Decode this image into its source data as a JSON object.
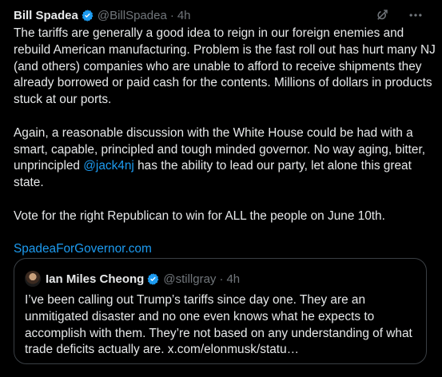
{
  "tweet": {
    "author_name": "Bill Spadea",
    "handle": "@BillSpadea",
    "separator": "·",
    "time": "4h",
    "paragraphs": [
      "The tariffs are generally a good idea to reign in our foreign enemies and rebuild American manufacturing. Problem is the fast roll out has hurt many NJ (and others) companies who are unable to afford to receive shipments they already borrowed or paid cash for the contents. Millions of dollars in products stuck at our ports.",
      "Again, a reasonable discussion with the White House could be had with a smart, capable, principled and tough minded governor. No way aging, bitter, unprincipled ",
      " has the ability to lead our party, let alone this great state.",
      "Vote for the right Republican to win for ALL the people on June 10th."
    ],
    "mention": "@jack4nj",
    "link": "SpadeaForGovernor.com"
  },
  "quote": {
    "author_name": "Ian Miles Cheong",
    "handle": "@stillgray",
    "separator": "·",
    "time": "4h",
    "text": "I’ve been calling out Trump’s tariffs since day one. They are an unmitigated disaster and no one even knows what he expects to accomplish with them. They’re not based on any understanding of what trade deficits actually are. x.com/elonmusk/statu…"
  },
  "icons": {
    "grok": "grok-icon",
    "more": "more-options-icon",
    "verified": "verified-badge-icon"
  },
  "colors": {
    "background": "#000000",
    "text": "#e7e9ea",
    "secondary": "#71767b",
    "link": "#1d9bf0",
    "border": "#3a3f44"
  }
}
